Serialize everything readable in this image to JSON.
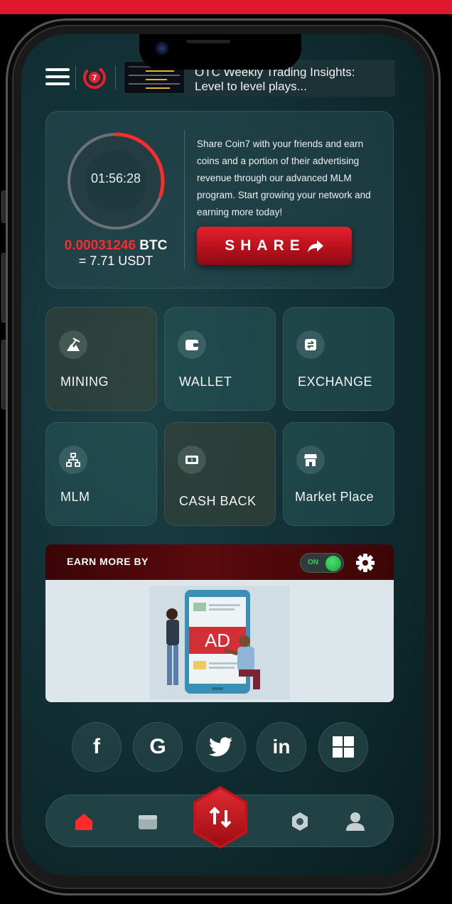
{
  "header": {
    "menu_icon": "hamburger-menu-icon",
    "logo_badge": "7",
    "news_title": "OTC Weekly Trading Insights: Level to level plays..."
  },
  "reward": {
    "timer": "01:56:28",
    "timer_progress_fraction": 0.3,
    "btc_amount": "0.00031246",
    "btc_unit": "BTC",
    "usdt_value": "= 7.71 USDT",
    "share_description": "Share Coin7 with your friends and earn coins and a portion of their advertising revenue through our advanced MLM program. Start growing your network and earning more today!",
    "share_button_label": "SHARE"
  },
  "tiles": [
    {
      "label": "MINING",
      "icon": "mining-icon"
    },
    {
      "label": "WALLET",
      "icon": "wallet-icon"
    },
    {
      "label": "EXCHANGE",
      "icon": "exchange-icon"
    },
    {
      "label": "MLM",
      "icon": "network-icon"
    },
    {
      "label": "CASH BACK",
      "icon": "cash-back-icon"
    },
    {
      "label": "Market Place",
      "icon": "store-icon"
    }
  ],
  "earn_more": {
    "title": "EARN MORE BY",
    "toggle_label": "ON",
    "toggle_state": "on",
    "ad_text": "AD"
  },
  "social": [
    {
      "name": "facebook",
      "glyph": "f"
    },
    {
      "name": "google",
      "glyph": "G"
    },
    {
      "name": "twitter",
      "glyph": ""
    },
    {
      "name": "linkedin",
      "glyph": "in"
    },
    {
      "name": "microsoft",
      "glyph": ""
    }
  ],
  "nav": {
    "active": "home",
    "items": [
      "home-icon",
      "wallet-icon",
      "trade-icon",
      "settings-icon",
      "profile-icon"
    ]
  },
  "colors": {
    "accent_red": "#e3212c",
    "btc_red": "#ff2a2a",
    "toggle_green": "#2ecc52",
    "background": "#133238"
  }
}
